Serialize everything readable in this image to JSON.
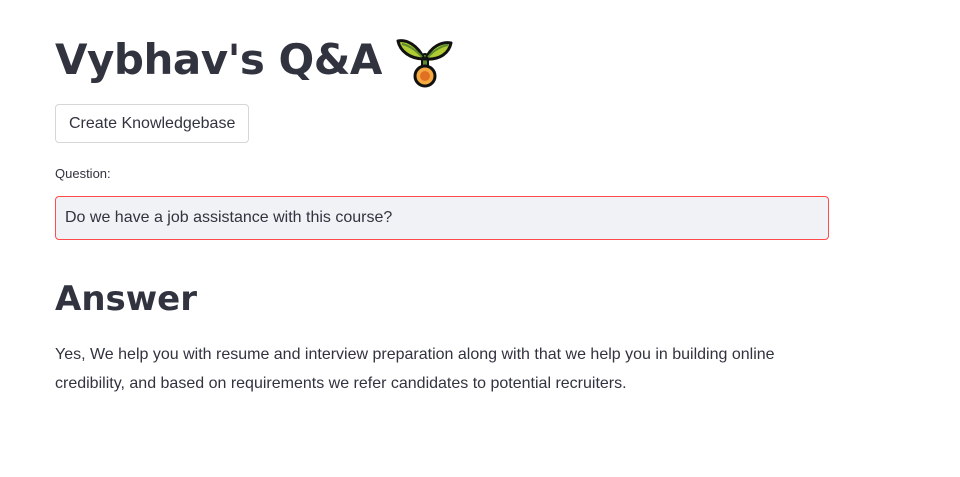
{
  "page": {
    "title": "Vybhav's Q&A",
    "title_icon": "sprout-icon"
  },
  "toolbar": {
    "create_label": "Create Knowledgebase"
  },
  "question": {
    "label": "Question:",
    "value": "Do we have a job assistance with this course?"
  },
  "answer": {
    "heading": "Answer",
    "text": "Yes, We help you with resume and interview preparation along with that we help you in building online credibility, and based on requirements we refer candidates to potential recruiters."
  },
  "colors": {
    "text": "#31333f",
    "input_bg": "#f0f2f6",
    "input_border": "#ff4b4b",
    "button_border": "#d6d6d9"
  }
}
